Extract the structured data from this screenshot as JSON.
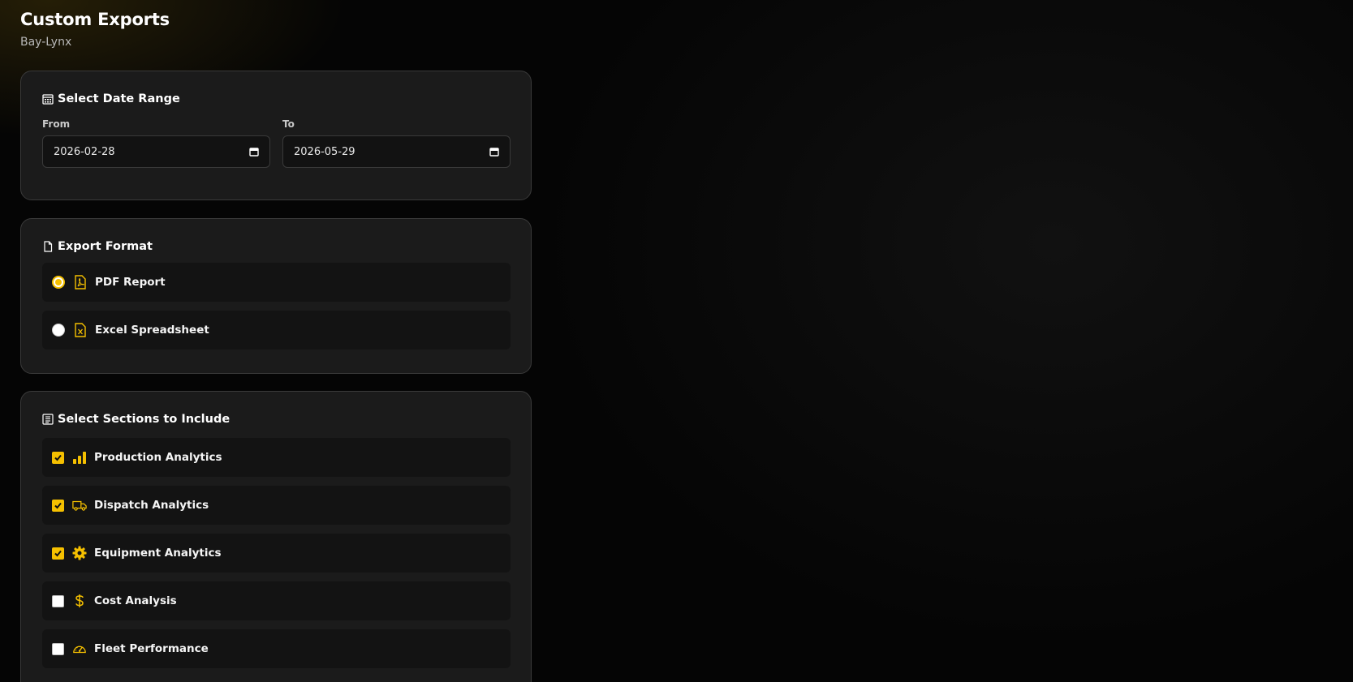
{
  "header": {
    "title": "Custom Exports",
    "subtitle": "Bay-Lynx"
  },
  "date_range": {
    "title": "Select Date Range",
    "icon": "calendar-icon",
    "from_label": "From",
    "from_value": "2026-02-28",
    "to_label": "To",
    "to_value": "2026-05-29"
  },
  "export_format": {
    "title": "Export Format",
    "icon": "file-icon",
    "options": [
      {
        "label": "PDF Report",
        "icon": "pdf-file-icon",
        "selected": true
      },
      {
        "label": "Excel Spreadsheet",
        "icon": "excel-file-icon",
        "selected": false
      }
    ]
  },
  "sections": {
    "title": "Select Sections to Include",
    "icon": "list-document-icon",
    "items": [
      {
        "label": "Production Analytics",
        "icon": "bar-chart-icon",
        "checked": true
      },
      {
        "label": "Dispatch Analytics",
        "icon": "truck-icon",
        "checked": true
      },
      {
        "label": "Equipment Analytics",
        "icon": "gear-icon",
        "checked": true
      },
      {
        "label": "Cost Analysis",
        "icon": "dollar-icon",
        "checked": false
      },
      {
        "label": "Fleet Performance",
        "icon": "speedometer-icon",
        "checked": false
      }
    ]
  },
  "colors": {
    "accent": "#f5c000",
    "card_bg": "#1b1b1b",
    "page_bg": "#050505"
  }
}
